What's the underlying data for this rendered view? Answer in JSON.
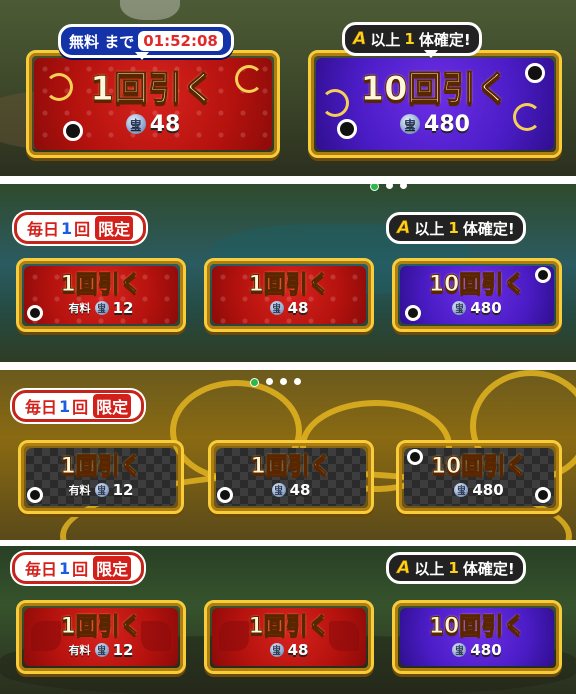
{
  "panel1": {
    "free_badge": {
      "label": "無料 まで",
      "timer": "01:52:08"
    },
    "guarantee_badge": {
      "prefix": "A",
      "text1": "以上",
      "count": "1",
      "text2": "体確定!"
    },
    "single_button": {
      "label": "1回引く",
      "currency_icon": "宝",
      "cost": "48",
      "color": "#c0150f"
    },
    "ten_button": {
      "label": "10回引く",
      "currency_icon": "宝",
      "cost": "480",
      "color": "#5221cf"
    }
  },
  "panel2": {
    "page_dots": {
      "count": 3,
      "active": 0
    },
    "daily_badge": {
      "p1": "毎日",
      "count": "1",
      "p2": "回",
      "limit": "限定"
    },
    "guarantee_badge": {
      "prefix": "A",
      "text1": "以上",
      "count": "1",
      "text2": "体確定!"
    },
    "paid_button": {
      "label": "1回引く",
      "prefix": "有料",
      "currency_icon": "宝",
      "cost": "12"
    },
    "single_button": {
      "label": "1回引く",
      "currency_icon": "宝",
      "cost": "48"
    },
    "ten_button": {
      "label": "10回引く",
      "currency_icon": "宝",
      "cost": "480"
    }
  },
  "panel3": {
    "page_dots": {
      "count": 4,
      "active": 0
    },
    "daily_badge": {
      "p1": "毎日",
      "count": "1",
      "p2": "回",
      "limit": "限定"
    },
    "paid_button": {
      "label": "1回引く",
      "prefix": "有料",
      "currency_icon": "宝",
      "cost": "12"
    },
    "single_button": {
      "label": "1回引く",
      "currency_icon": "宝",
      "cost": "48"
    },
    "ten_button": {
      "label": "10回引く",
      "currency_icon": "宝",
      "cost": "480"
    }
  },
  "panel4": {
    "daily_badge": {
      "p1": "毎日",
      "count": "1",
      "p2": "回",
      "limit": "限定"
    },
    "guarantee_badge": {
      "prefix": "A",
      "text1": "以上",
      "count": "1",
      "text2": "体確定!"
    },
    "paid_button": {
      "label": "1回引く",
      "prefix": "有料",
      "currency_icon": "宝",
      "cost": "12"
    },
    "single_button": {
      "label": "1回引く",
      "currency_icon": "宝",
      "cost": "48"
    },
    "ten_button": {
      "label": "10回引く",
      "currency_icon": "宝",
      "cost": "480"
    }
  },
  "colors": {
    "gold_border": "#f7cd3a",
    "red": "#c0150f",
    "purple": "#5221cf",
    "black_check": "#2b2b2b",
    "timer_red": "#e02a2a",
    "free_badge_blue": "#1433a8",
    "active_dot": "#2db84a"
  }
}
